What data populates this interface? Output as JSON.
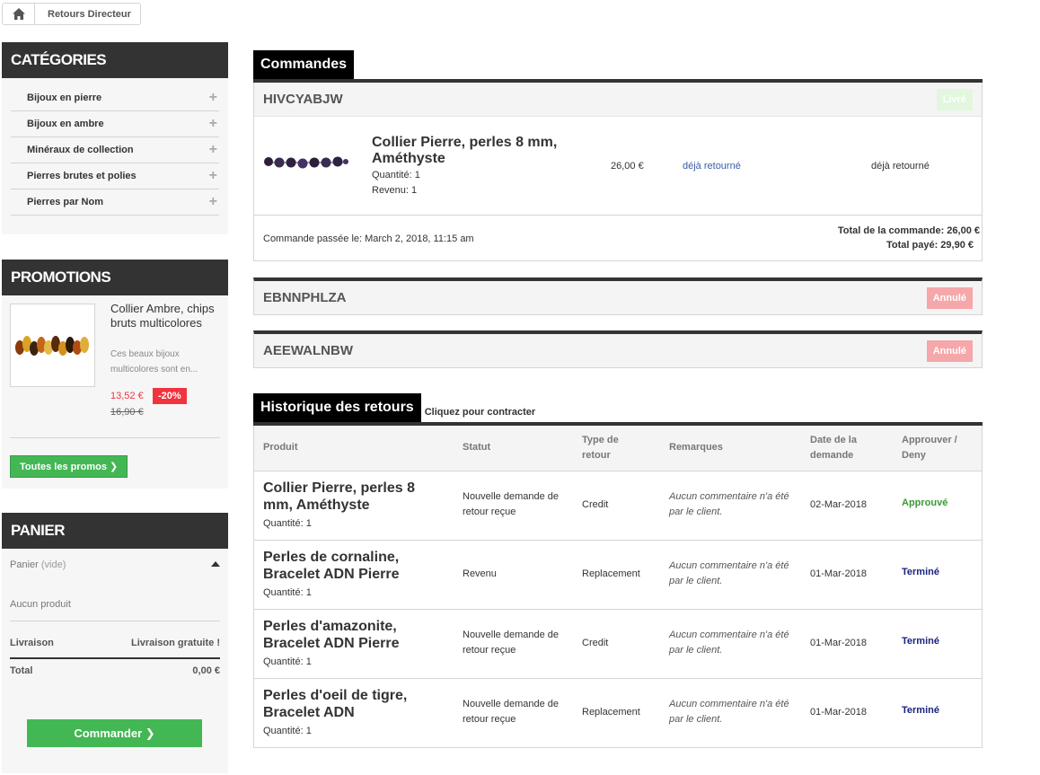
{
  "breadcrumb": {
    "home_icon": "home-icon",
    "current": "Retours Directeur"
  },
  "categories": {
    "title": "Catégories",
    "items": [
      {
        "label": "Bijoux en pierre"
      },
      {
        "label": "Bijoux en ambre"
      },
      {
        "label": "Minéraux de collection"
      },
      {
        "label": "Pierres brutes et polies"
      },
      {
        "label": "Pierres par Nom"
      }
    ],
    "expand_icon": "+"
  },
  "promotions": {
    "title": "Promotions",
    "product_name": "Collier Ambre, chips bruts multicolores",
    "description": "Ces beaux bijoux multicolores sont en...",
    "price": "13,52 €",
    "discount": "-20%",
    "old_price": "16,90 €",
    "button": "Toutes les promos ❯"
  },
  "cart": {
    "title": "Panier",
    "label": "Panier",
    "empty_note": "(vide)",
    "no_product": "Aucun produit",
    "shipping_label": "Livraison",
    "shipping_value": "Livraison gratuite !",
    "total_label": "Total",
    "total_value": "0,00 €",
    "checkout": "Commander ❯"
  },
  "orders_section": {
    "title": "Commandes"
  },
  "orders": [
    {
      "ref": "HIVCYABJW",
      "status": "Livré",
      "status_color": "#e2f7dd",
      "item": {
        "name": "Collier Pierre, perles 8 mm, Améthyste",
        "qty": "Quantité: 1",
        "revenue": "Revenu: 1",
        "price": "26,00 €",
        "link": "déjà retourné",
        "status": "déjà retourné"
      },
      "placed": "Commande passée le: March 2, 2018, 11:15 am",
      "total_order": "Total de la commande: 26,00 €",
      "total_paid": "Total payé: 29,90 €"
    },
    {
      "ref": "EBNNPHLZA",
      "status": "Annulé",
      "status_color": "#f5a7a9"
    },
    {
      "ref": "AEEWALNBW",
      "status": "Annulé",
      "status_color": "#f5a7a9"
    }
  ],
  "returns": {
    "title": "Historique des retours",
    "toggle": "Cliquez pour contracter",
    "headers": {
      "product": "Produit",
      "status": "Statut",
      "type": "Type de retour",
      "remarks": "Remarques",
      "date": "Date de la demande",
      "approve": "Approuver / Deny"
    },
    "rows": [
      {
        "product": "Collier Pierre, perles 8 mm, Améthyste",
        "qty": "Quantité: 1",
        "status": "Nouvelle demande de retour reçue",
        "type": "Credit",
        "remarks": "Aucun commentaire n'a été par le client.",
        "date": "02-Mar-2018",
        "decision": "Approuvé",
        "decision_color": "#3a9a36"
      },
      {
        "product": "Perles de cornaline, Bracelet ADN Pierre",
        "qty": "Quantité: 1",
        "status": "Revenu",
        "type": "Replacement",
        "remarks": "Aucun commentaire n'a été par le client.",
        "date": "01-Mar-2018",
        "decision": "Terminé",
        "decision_color": "#1a237e"
      },
      {
        "product": "Perles d'amazonite, Bracelet ADN Pierre",
        "qty": "Quantité: 1",
        "status": "Nouvelle demande de retour reçue",
        "type": "Credit",
        "remarks": "Aucun commentaire n'a été par le client.",
        "date": "01-Mar-2018",
        "decision": "Terminé",
        "decision_color": "#1a237e"
      },
      {
        "product": "Perles d'oeil de tigre, Bracelet ADN",
        "qty": "Quantité: 1",
        "status": "Nouvelle demande de retour reçue",
        "type": "Replacement",
        "remarks": "Aucun commentaire n'a été par le client.",
        "date": "01-Mar-2018",
        "decision": "Terminé",
        "decision_color": "#1a237e"
      }
    ]
  }
}
